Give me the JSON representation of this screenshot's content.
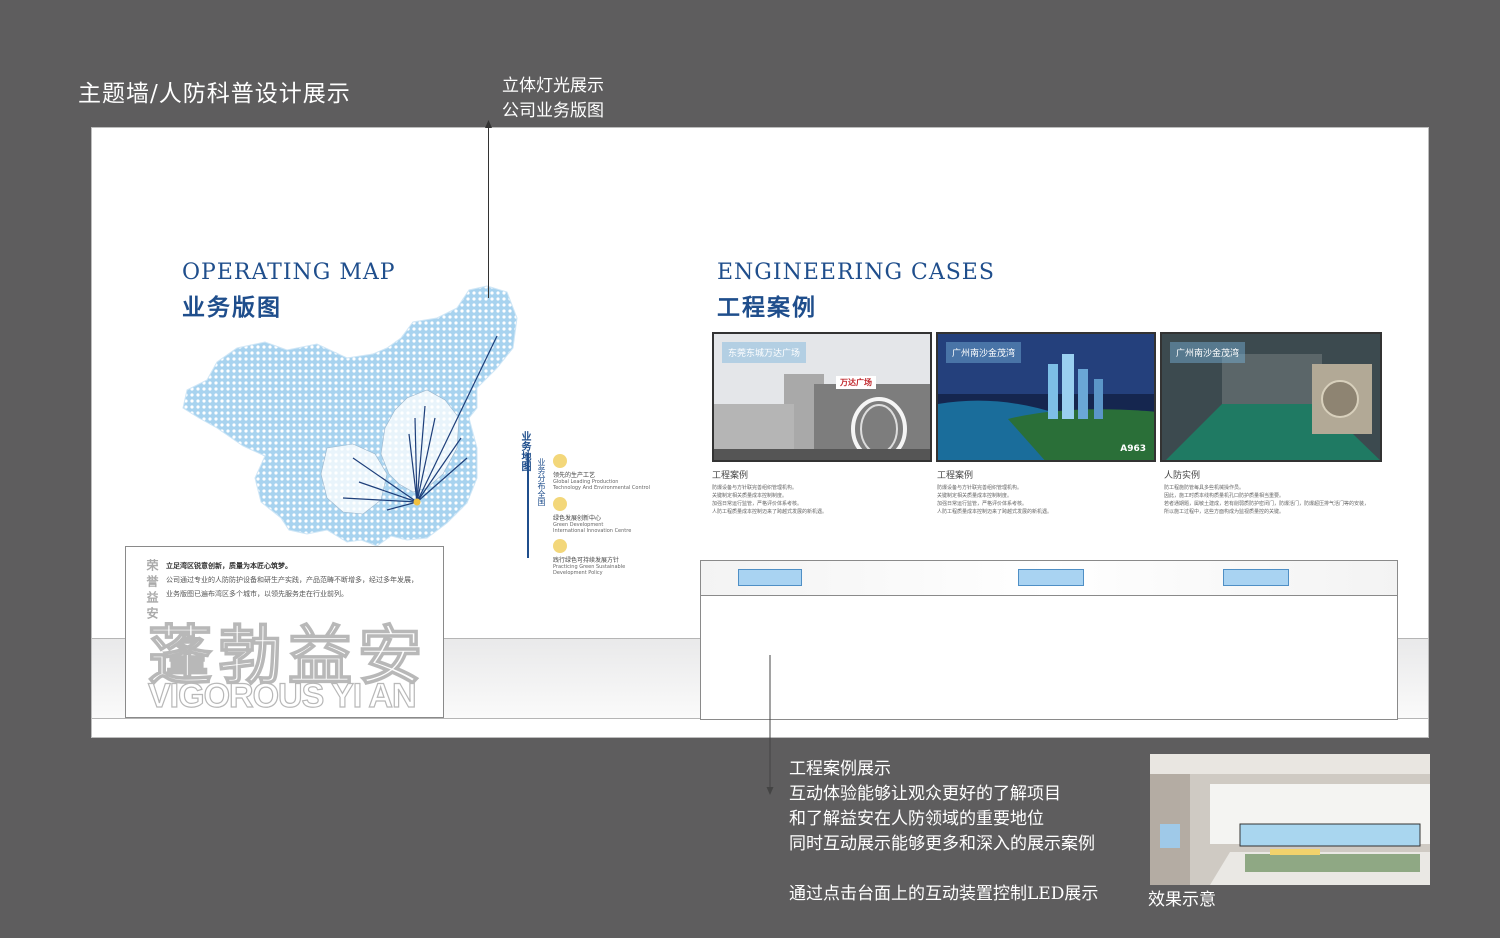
{
  "page": {
    "title": "主题墙/人防科普设计展示"
  },
  "annotations": {
    "top": [
      "立体灯光展示",
      "公司业务版图"
    ],
    "bottom": [
      "工程案例展示",
      "互动体验能够让观众更好的了解项目",
      "和了解益安在人防领域的重要地位",
      "同时互动展示能够更多和深入的展示案例",
      "",
      "通过点击台面上的互动装置控制LED展示"
    ],
    "effect_caption": "效果示意"
  },
  "operating_map": {
    "title_en": "OPERATING MAP",
    "title_cn": "业务版图",
    "side_label": "业务地图",
    "side_sub": "业务分布全国",
    "legend": [
      {
        "head": "领先的生产工艺",
        "sub1": "Global Leading Production",
        "sub2": "Technology And Environmental Control"
      },
      {
        "head": "绿色发展创新中心",
        "sub1": "Green Development",
        "sub2": "International Innovation Centre"
      },
      {
        "head": "践行绿色可持续发展方针",
        "sub1": "Practicing Green Sustainable",
        "sub2": "Development Policy"
      }
    ],
    "colors": {
      "map": "#a8d3ef",
      "accent": "#1f4e8c",
      "lines": "#1e3f7a"
    }
  },
  "intro": {
    "vertical": "荣誉益安",
    "lines": [
      "立足湾区锐意创新，质量为本匠心筑梦。",
      "公司通过专业的人防防护设备和研生产实践，产品范畴不断增多，经过多年发展，",
      "业务版图已遍布湾区多个城市，以领先服务走在行业前列。"
    ],
    "big_cn": "蓬勃益安",
    "big_en": "VIGOROUS YI AN"
  },
  "engineering": {
    "title_en": "ENGINEERING CASES",
    "title_cn": "工程案例",
    "cases": [
      {
        "label": "东莞东城万达广场",
        "sign": "万达广场",
        "title": "工程案例",
        "desc": [
          "防爆设备与方针联完善组织管理机构。",
          "关键制定相关质量成本控制制度。",
          "加强日常运行监管，严格评价体系考核。",
          "人防工程质量成本控制迈来了跨越式发展的新机遇。"
        ]
      },
      {
        "label": "广州南沙金茂湾",
        "sign": "A963",
        "title": "工程案例",
        "desc": [
          "防爆设备与方针联完善组织管理机构。",
          "关键制定相关质量成本控制制度。",
          "加强日常运行监管，严格评价体系考核。",
          "人防工程质量成本控制迈来了跨越式发展的新机遇。"
        ]
      },
      {
        "label": "广州南沙金茂湾",
        "sign": "",
        "title": "人防实例",
        "desc": [
          "防工程施防管每具多些机械操作员。",
          "因此，施工时质本线构质量机孔口防护质量相当重要。",
          "若者通期题，属敏土建成，若有削弱质防护密闭门，防爆活门，防爆超压排气活门等的安装，",
          "所以施工过程中，这些方面构成为监视质量控的关键。"
        ]
      }
    ]
  }
}
